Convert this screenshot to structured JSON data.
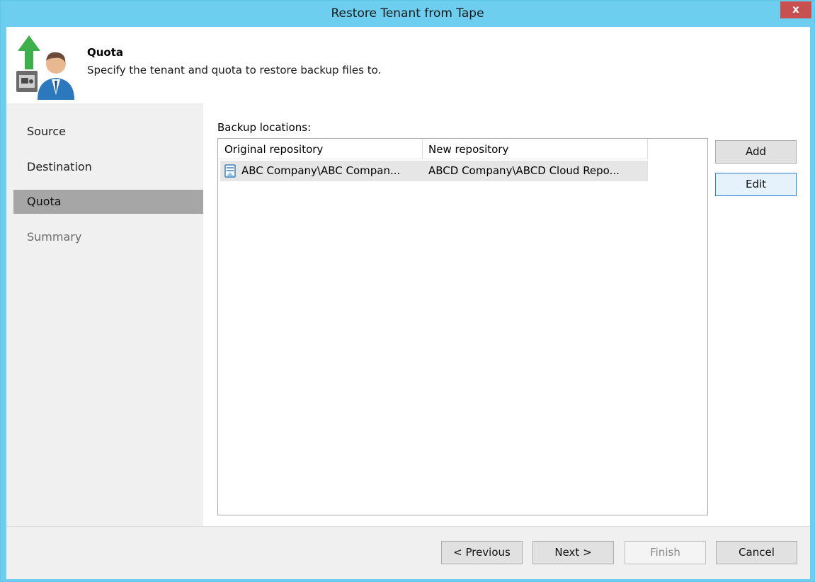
{
  "window": {
    "title": "Restore Tenant from Tape",
    "close_label": "x"
  },
  "header": {
    "title": "Quota",
    "description": "Specify the tenant and quota to restore backup files to.",
    "icon": "restore-tenant-icon"
  },
  "nav": {
    "items": [
      {
        "label": "Source",
        "state": "done"
      },
      {
        "label": "Destination",
        "state": "done"
      },
      {
        "label": "Quota",
        "state": "active"
      },
      {
        "label": "Summary",
        "state": "disabled"
      }
    ]
  },
  "main": {
    "locations_label": "Backup locations:",
    "columns": [
      "Original repository",
      "New repository"
    ],
    "rows": [
      {
        "icon": "repository-icon",
        "original": "ABC Company\\ABC Compan...",
        "new": "ABCD Company\\ABCD Cloud Repo..."
      }
    ],
    "add_label": "Add",
    "edit_label": "Edit"
  },
  "footer": {
    "previous_label": "< Previous",
    "next_label": "Next >",
    "finish_label": "Finish",
    "cancel_label": "Cancel"
  },
  "colors": {
    "titlebar": "#6dcef0",
    "close": "#c75050",
    "nav_active": "#a6a6a6",
    "focus_border": "#2f7fd1"
  }
}
